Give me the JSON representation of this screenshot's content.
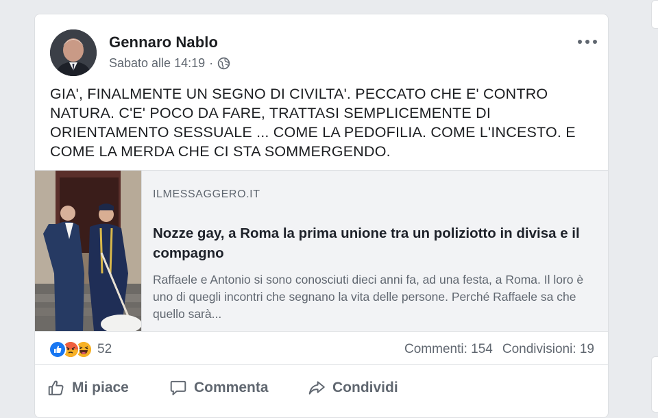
{
  "post": {
    "author": "Gennaro Nablo",
    "timestamp": "Sabato alle 14:19",
    "separator": "·",
    "audience_icon": "globe-icon",
    "text": "GIA', FINALMENTE UN SEGNO DI CIVILTA'. PECCATO CHE E' CONTRO NATURA. C'E' POCO DA FARE, TRATTASI SEMPLICEMENTE DI ORIENTAMENTO SESSUALE ... COME LA PEDOFILIA. COME L'INCESTO. E COME LA MERDA CHE CI STA SOMMERGENDO."
  },
  "link": {
    "domain": "ILMESSAGGERO.IT",
    "title": "Nozze gay, a Roma la prima unione tra un poliziotto in divisa e il compagno",
    "description": "Raffaele e Antonio si sono conosciuti dieci anni fa, ad una festa, a Roma. Il loro è uno di quegli incontri che segnano la vita delle persone. Perché Raffaele sa che quello sarà..."
  },
  "stats": {
    "reaction_icons": [
      "like-icon",
      "angry-icon",
      "haha-icon"
    ],
    "reaction_count": "52",
    "comments": "Commenti: 154",
    "shares": "Condivisioni: 19"
  },
  "actions": {
    "like": "Mi piace",
    "comment": "Commenta",
    "share": "Condividi"
  },
  "colors": {
    "like": "#1877f2",
    "angry": "#e9710f",
    "haha": "#f7b125",
    "text_secondary": "#606770"
  }
}
